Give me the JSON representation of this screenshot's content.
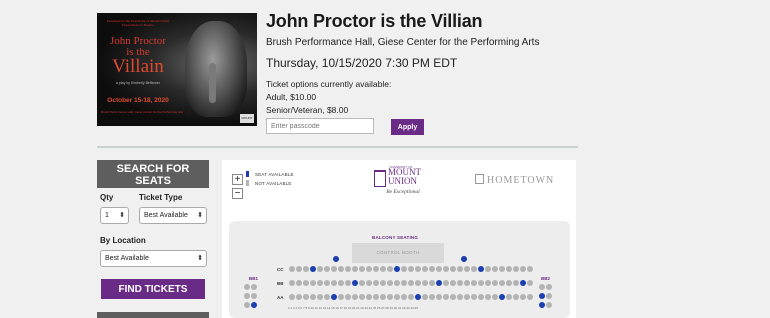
{
  "event": {
    "poster": {
      "top_text": "Presented by the University of Mount Union Department of Theatre",
      "title_line1": "John Proctor",
      "title_line2": "is the",
      "title_line3": "Villain",
      "subtitle": "a play by Kimberly Belflower",
      "dates": "October 15-18, 2020",
      "fine_print": "Brush Performance Hall, Giese Center for the Performing Arts",
      "logo_text": "MOUNT UNION"
    },
    "title": "John Proctor is the Villian",
    "venue": "Brush Performance Hall, Giese Center for the Performing Arts",
    "datetime": "Thursday, 10/15/2020 7:30 PM EDT",
    "options_heading": "Ticket options currently available:",
    "prices": [
      "Adult, $10.00",
      "Senior/Veteran, $8.00"
    ],
    "passcode_placeholder": "Enter passcode",
    "apply_label": "Apply"
  },
  "search": {
    "heading_line1": "SEARCH FOR",
    "heading_line2": "SEATS",
    "qty_label": "Qty",
    "ticket_type_label": "Ticket Type",
    "qty_value": "1",
    "ticket_type_value": "Best Available",
    "location_label": "By Location",
    "location_value": "Best Available",
    "find_label": "FIND TICKETS"
  },
  "seat_map": {
    "zoom_in": "+",
    "zoom_out": "−",
    "legend_available": "SEAT AVAILABLE",
    "legend_unavailable": "NOT AVAILABLE",
    "colors": {
      "available": "#1b3fb3",
      "unavailable": "#b3b3b3",
      "accent": "#6a2b86"
    },
    "sponsor1": {
      "small": "UNIVERSITY OF",
      "name_line1": "MOUNT",
      "name_line2": "UNION",
      "tagline": "Be Exceptional"
    },
    "sponsor2": "HOMETOWN",
    "balcony_label": "BALCONY SEATING",
    "booth_label": "CONTROL BOOTH",
    "box_left": "BB1",
    "box_right": "BB2",
    "rows": [
      "CC",
      "BB",
      "AA"
    ],
    "seat_numbers": "1 2 3 4 5 6 7 8 9 10 11 12 13 14 15 16 17 18 19 20 21 22 23 24 25 26 27 28 29 30 31 32 33 34 35"
  }
}
